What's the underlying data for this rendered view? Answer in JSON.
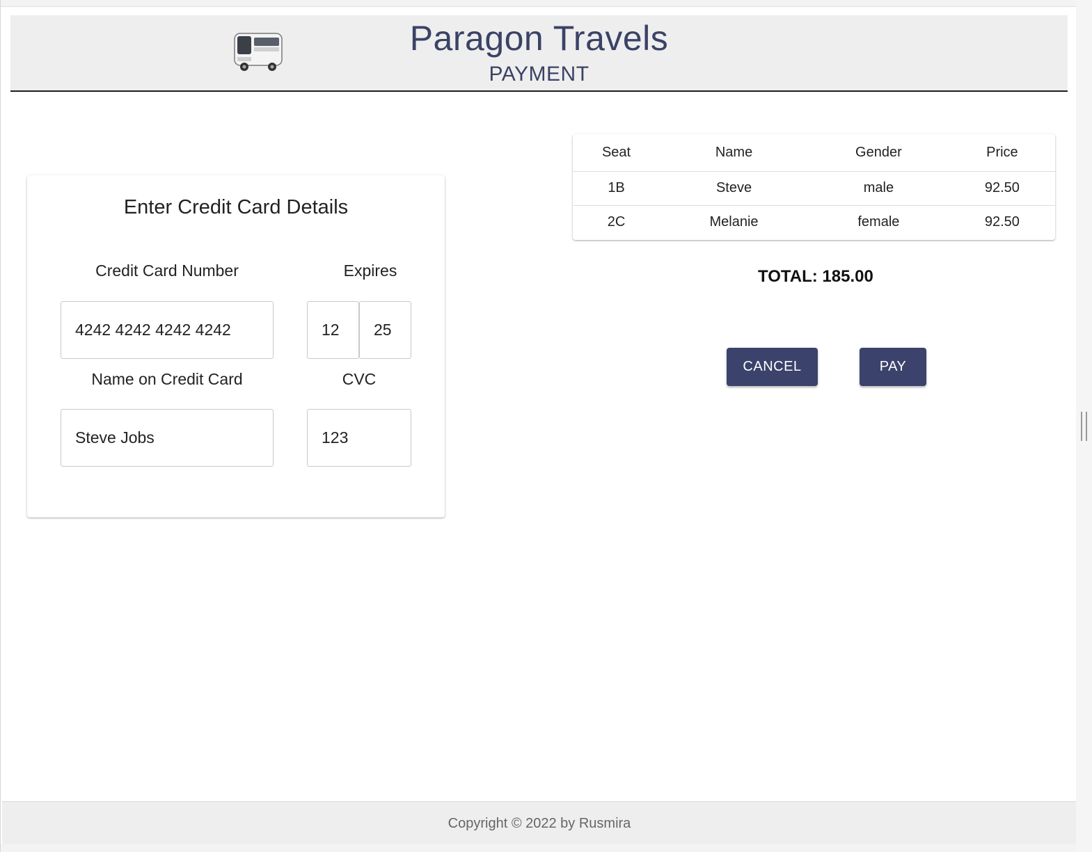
{
  "header": {
    "title": "Paragon Travels",
    "subtitle": "PAYMENT",
    "logo_icon": "bus-icon"
  },
  "card_form": {
    "title": "Enter Credit Card Details",
    "card_number_label": "Credit Card Number",
    "card_number_value": "4242 4242 4242 4242",
    "expires_label": "Expires",
    "expires_month": "12",
    "expires_year": "25",
    "name_label": "Name on Credit Card",
    "name_value": "Steve Jobs",
    "cvc_label": "CVC",
    "cvc_value": "123"
  },
  "table": {
    "columns": [
      "Seat",
      "Name",
      "Gender",
      "Price"
    ],
    "rows": [
      [
        "1B",
        "Steve",
        "male",
        "92.50"
      ],
      [
        "2C",
        "Melanie",
        "female",
        "92.50"
      ]
    ]
  },
  "summary": {
    "total": "TOTAL: 185.00"
  },
  "actions": {
    "cancel_label": "CANCEL",
    "pay_label": "PAY"
  },
  "footer": {
    "copyright": "Copyright © 2022 by Rusmira"
  },
  "colors": {
    "brand": "#3b426b",
    "header_bg": "#eeeeee"
  }
}
